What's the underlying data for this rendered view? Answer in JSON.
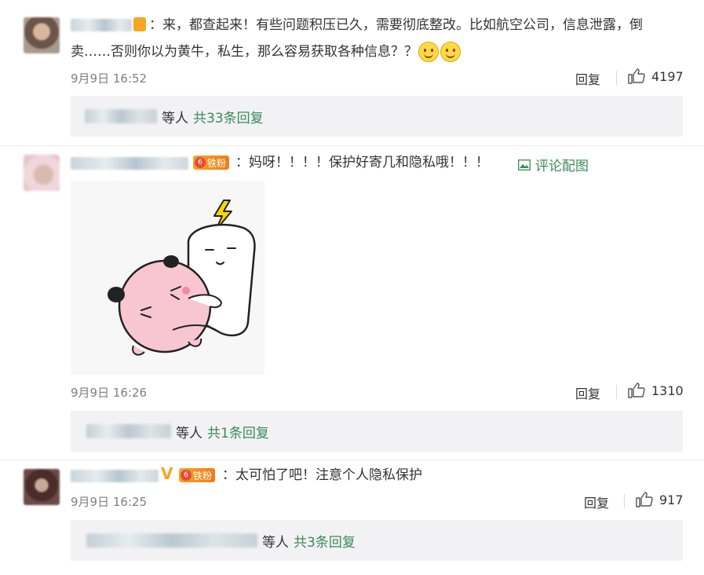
{
  "comments": [
    {
      "text_line1": "：来，都查起来！有些问题积压已久，需要彻底整改。比如航空公司，信息泄露，倒",
      "text_line2": "卖……否则你以为黄牛，私生，那么容易获取各种信息？？",
      "time": "9月9日 16:52",
      "reply": "回复",
      "likes": "4197",
      "sub_suffix": "等人",
      "sub_count": "共33条回复"
    },
    {
      "badge": "铁粉",
      "text": "：妈呀！！！！保护好寄几和隐私哦！！！",
      "image_link": "评论配图",
      "time": "9月9日 16:26",
      "reply": "回复",
      "likes": "1310",
      "sub_suffix": "等人",
      "sub_count": "共1条回复"
    },
    {
      "badge": "铁粉",
      "verified": "V",
      "text": "：太可怕了吧！注意个人隐私保护",
      "time": "9月9日 16:25",
      "reply": "回复",
      "likes": "917",
      "sub_suffix": "等人",
      "sub_count": "共3条回复"
    }
  ],
  "badge_level": "6",
  "icons": {
    "like": "thumb-up-icon",
    "image": "image-icon",
    "fan_badge": "fan-badge-icon",
    "emoji": "smile-emoji-icon"
  },
  "colors": {
    "link_green": "#3a8a5a",
    "meta_gray": "#808080",
    "sub_bg": "#f2f2f5"
  }
}
